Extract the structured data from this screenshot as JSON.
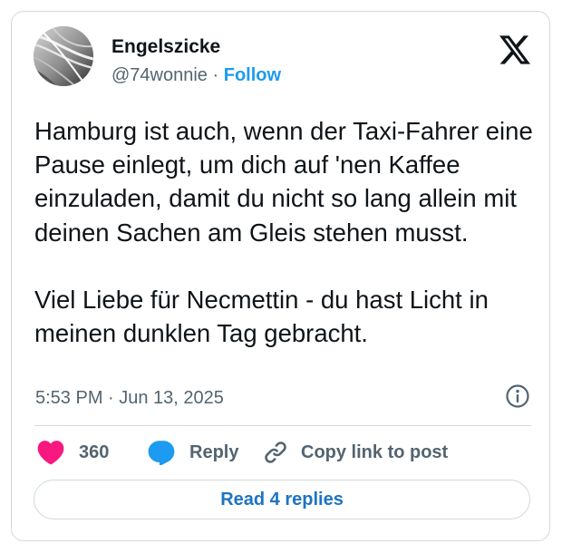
{
  "author": {
    "name": "Engelszicke",
    "handle": "@74wonnie",
    "separator": "·",
    "follow_label": "Follow"
  },
  "tweet": {
    "text": "Hamburg ist auch, wenn der Taxi-Fahrer eine Pause einlegt, um dich auf 'nen Kaffee einzuladen, damit du nicht so lang allein mit deinen Sachen am Gleis stehen musst.\n\nViel Liebe für Necmettin - du hast Licht in meinen dunklen Tag gebracht.",
    "timestamp": "5:53 PM · Jun 13, 2025"
  },
  "actions": {
    "likes_count": "360",
    "reply_label": "Reply",
    "copy_link_label": "Copy link to post"
  },
  "read_replies_label": "Read 4 replies",
  "icons": {
    "logo": "x-logo-icon",
    "info": "info-icon",
    "like": "heart-icon",
    "reply": "speech-bubble-icon",
    "copy": "link-icon"
  },
  "colors": {
    "follow": "#1d9bf0",
    "like": "#f91880",
    "reply": "#1d9bf0",
    "read_replies": "#1d73c4",
    "secondary_text": "#536471",
    "border": "#cfd9de"
  }
}
